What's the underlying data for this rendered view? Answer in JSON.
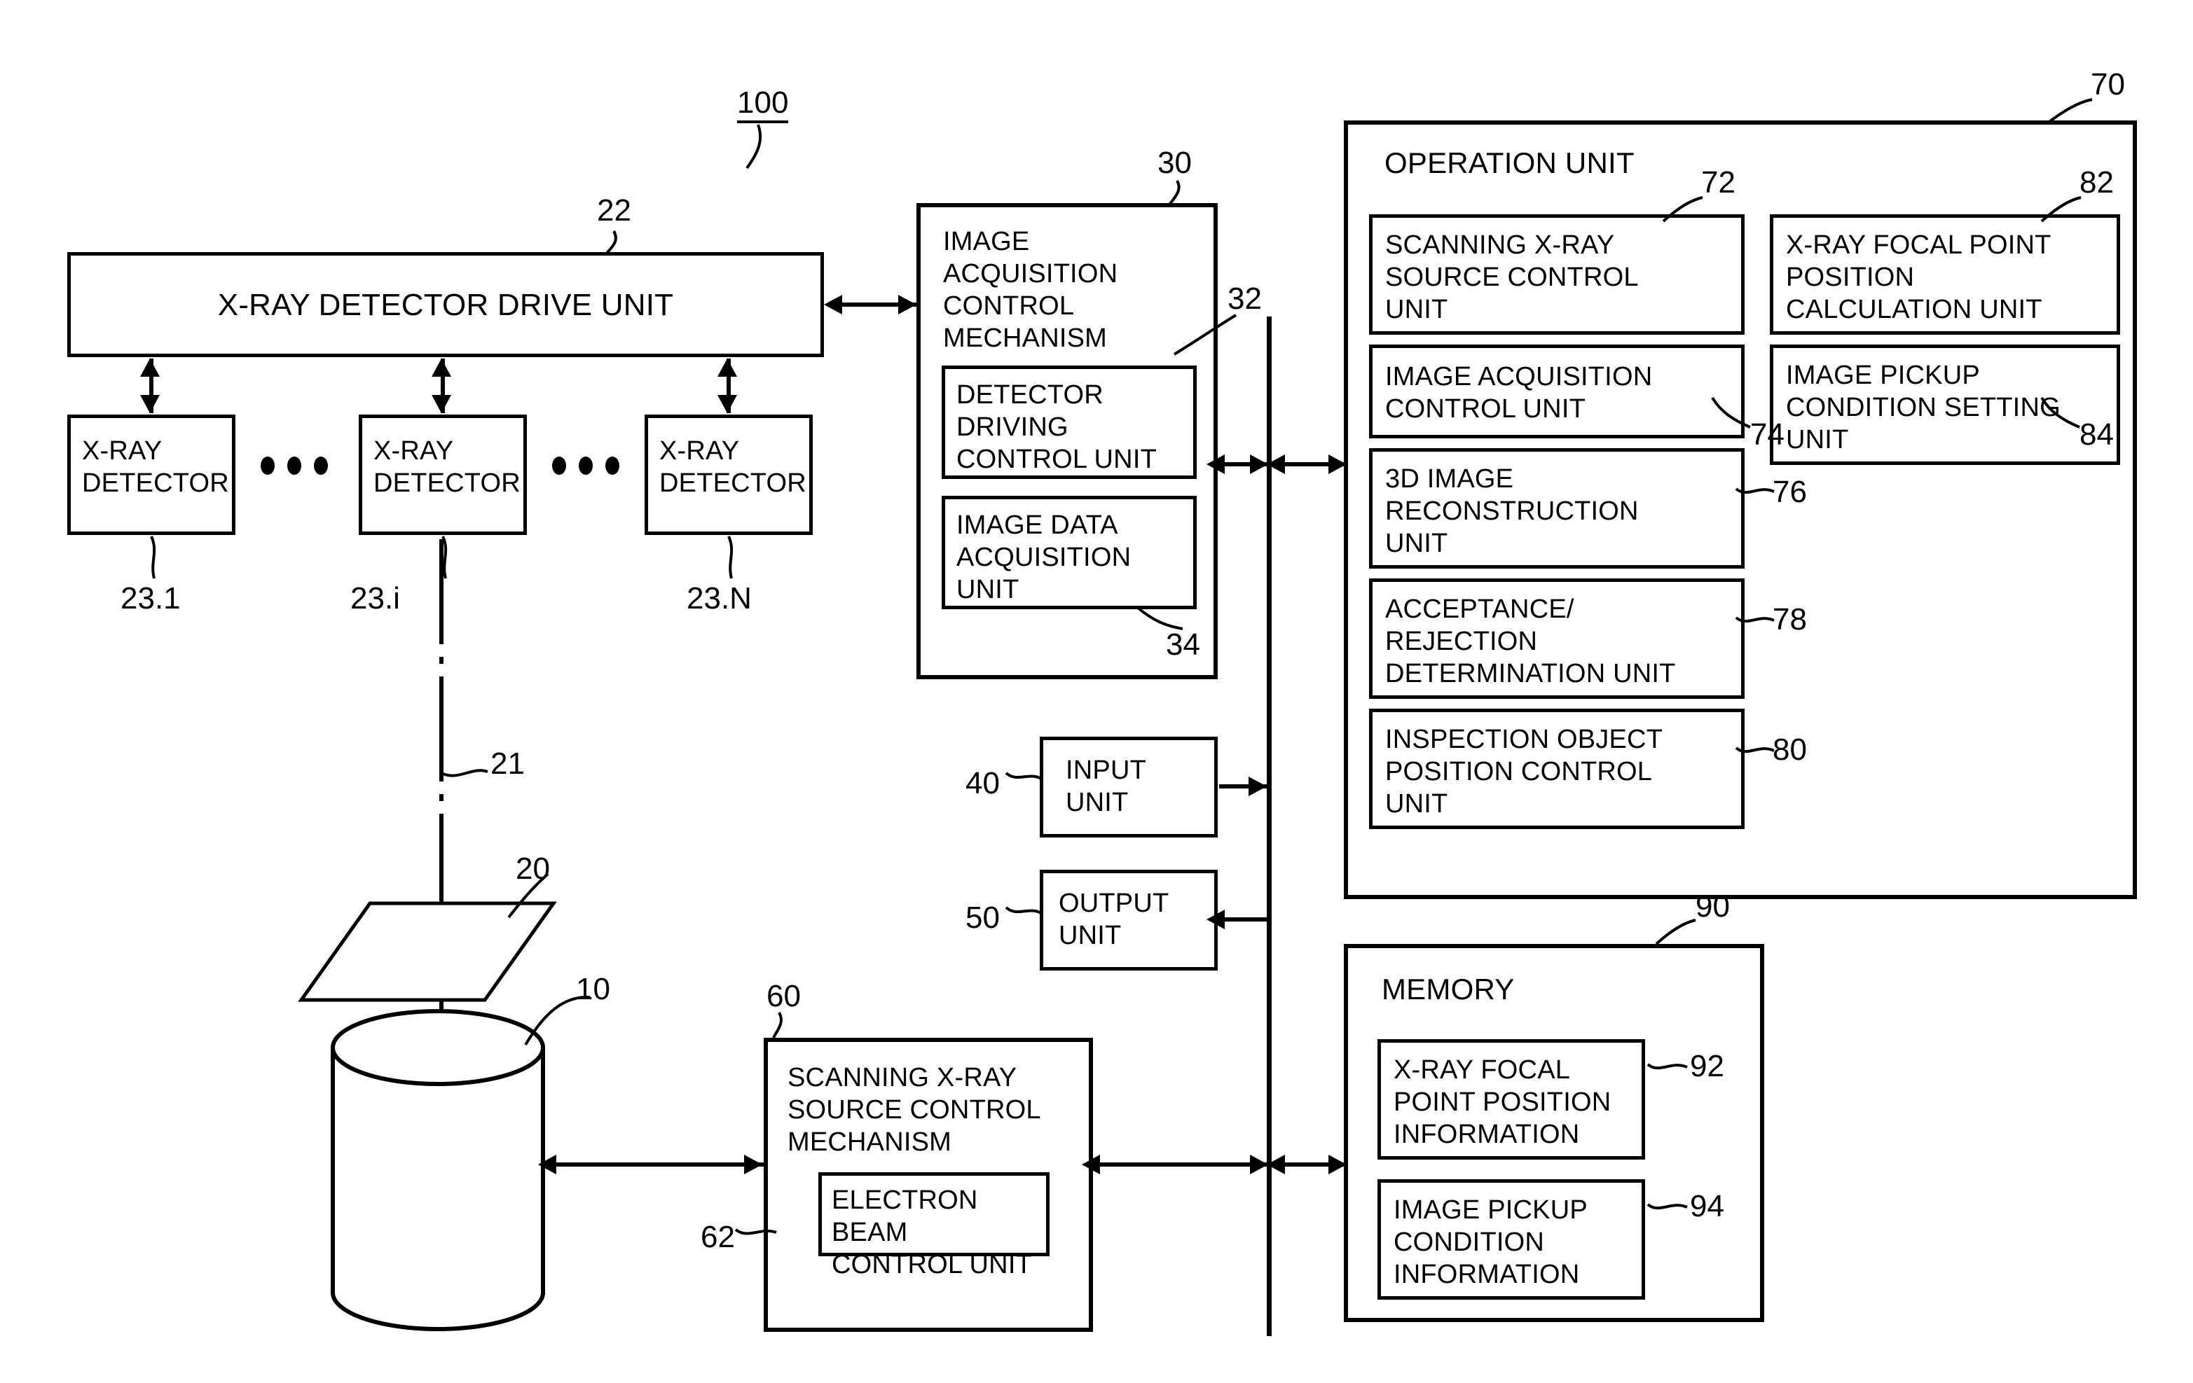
{
  "figure": {
    "system_number": "100",
    "blocks": {
      "xray_detector_drive_unit": {
        "label": "X-RAY DETECTOR DRIVE UNIT",
        "ref": "22"
      },
      "xray_detector_1": {
        "label": "X-RAY\nDETECTOR",
        "ref": "23.1"
      },
      "xray_detector_i": {
        "label": "X-RAY\nDETECTOR",
        "ref": "23.i"
      },
      "xray_detector_n": {
        "label": "X-RAY\nDETECTOR",
        "ref": "23.N"
      },
      "image_acquisition_control_mechanism": {
        "label": "IMAGE\nACQUISITION\nCONTROL\nMECHANISM",
        "ref": "30"
      },
      "detector_driving_control_unit": {
        "label": "DETECTOR\nDRIVING\nCONTROL UNIT",
        "ref": "32"
      },
      "image_data_acquisition_unit": {
        "label": "IMAGE DATA\nACQUISITION\nUNIT",
        "ref": "34"
      },
      "input_unit": {
        "label": "INPUT\nUNIT",
        "ref": "40"
      },
      "output_unit": {
        "label": "OUTPUT\nUNIT",
        "ref": "50"
      },
      "scanning_xray_source_control_mechanism": {
        "label": "SCANNING X-RAY\nSOURCE CONTROL\nMECHANISM",
        "ref": "60"
      },
      "electron_beam_control_unit": {
        "label": "ELECTRON BEAM\nCONTROL UNIT",
        "ref": "62"
      },
      "operation_unit": {
        "label": "OPERATION UNIT",
        "ref": "70"
      },
      "scanning_xray_source_control_unit": {
        "label": "SCANNING X-RAY\nSOURCE CONTROL\nUNIT",
        "ref": "72"
      },
      "image_acquisition_control_unit": {
        "label": "IMAGE ACQUISITION\nCONTROL UNIT",
        "ref": "74"
      },
      "three_d_image_reconstruction_unit": {
        "label": "3D IMAGE\nRECONSTRUCTION\nUNIT",
        "ref": "76"
      },
      "acceptance_rejection_determination_unit": {
        "label": "ACCEPTANCE/\nREJECTION\nDETERMINATION UNIT",
        "ref": "78"
      },
      "inspection_object_position_control_unit": {
        "label": "INSPECTION OBJECT\nPOSITION CONTROL\nUNIT",
        "ref": "80"
      },
      "xray_focal_point_position_calculation_unit": {
        "label": "X-RAY FOCAL POINT\nPOSITION\nCALCULATION UNIT",
        "ref": "82"
      },
      "image_pickup_condition_setting_unit": {
        "label": "IMAGE PICKUP\nCONDITION SETTING\nUNIT",
        "ref": "84"
      },
      "memory": {
        "label": "MEMORY",
        "ref": "90"
      },
      "xray_focal_point_position_information": {
        "label": "X-RAY FOCAL\nPOINT POSITION\nINFORMATION",
        "ref": "92"
      },
      "image_pickup_condition_information": {
        "label": "IMAGE PICKUP\nCONDITION\nINFORMATION",
        "ref": "94"
      }
    },
    "shapes": {
      "scanning_xray_source": {
        "ref": "10",
        "kind": "cylinder"
      },
      "inspection_object_stage": {
        "ref": "20",
        "kind": "parallelogram"
      },
      "optical_axis": {
        "ref": "21",
        "kind": "chain-line"
      }
    },
    "colors": {
      "ink": "#000000",
      "paper": "#ffffff"
    }
  }
}
